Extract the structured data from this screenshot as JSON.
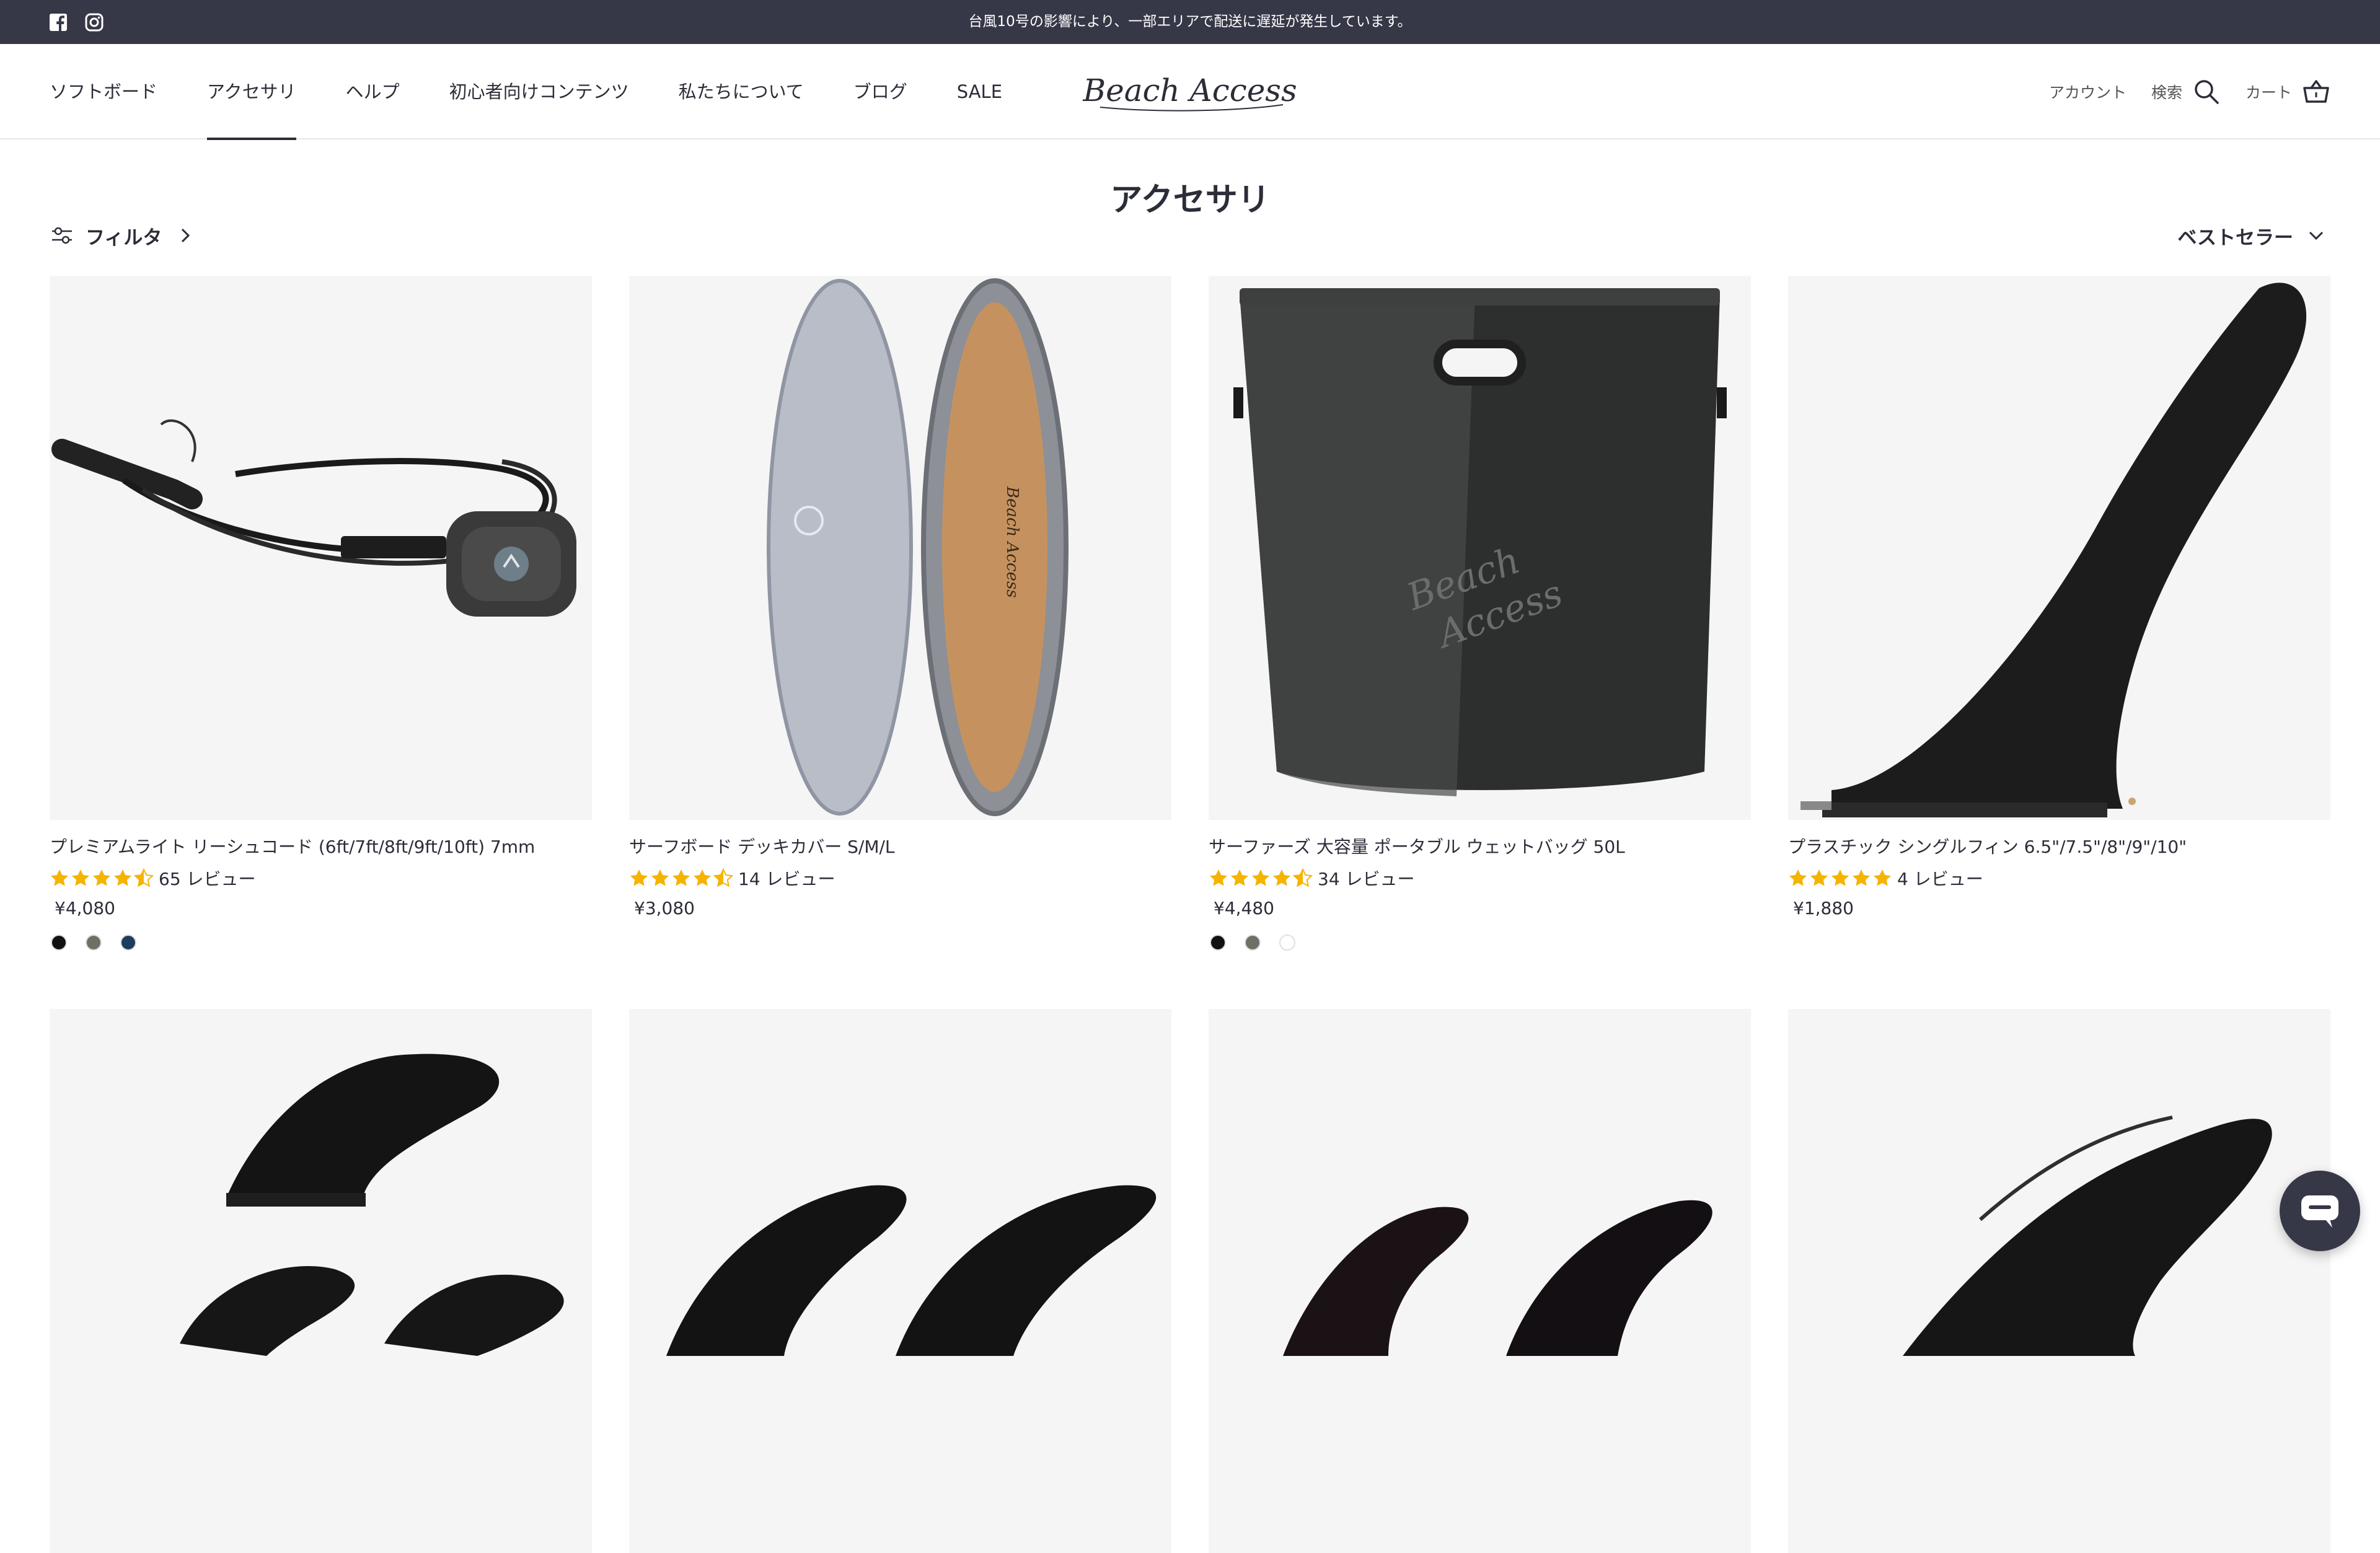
{
  "announcement": {
    "text": "台風10号の影響により、一部エリアで配送に遅延が発生しています。",
    "social_icons": [
      "facebook-icon",
      "instagram-icon"
    ]
  },
  "header": {
    "nav": [
      {
        "label": "ソフトボード",
        "active": false
      },
      {
        "label": "アクセサリ",
        "active": true
      },
      {
        "label": "ヘルプ",
        "active": false
      },
      {
        "label": "初心者向けコンテンツ",
        "active": false
      },
      {
        "label": "私たちについて",
        "active": false
      },
      {
        "label": "ブログ",
        "active": false
      },
      {
        "label": "SALE",
        "active": false
      }
    ],
    "logo_text": "Beach Access",
    "account_label": "アカウント",
    "search_label": "検索",
    "cart_label": "カート"
  },
  "page": {
    "title": "アクセサリ",
    "filter_label": "フィルタ",
    "sort_label": "ベストセラー"
  },
  "products": [
    {
      "name": "プレミアムライト リーシュコード (6ft/7ft/8ft/9ft/10ft) 7mm",
      "rating": 4.5,
      "reviews": "65 レビュー",
      "price": "¥4,080",
      "swatches": [
        "#111111",
        "#6f6f66",
        "#1d3d5c"
      ]
    },
    {
      "name": "サーフボード デッキカバー S/M/L",
      "rating": 4.5,
      "reviews": "14 レビュー",
      "price": "¥3,080",
      "swatches": []
    },
    {
      "name": "サーファーズ 大容量 ポータブル ウェットバッグ 50L",
      "rating": 4.5,
      "reviews": "34 レビュー",
      "price": "¥4,480",
      "swatches": [
        "#111111",
        "#6f6f66",
        "#ffffff"
      ]
    },
    {
      "name": "プラスチック シングルフィン 6.5\"/7.5\"/8\"/9\"/10\"",
      "rating": 5,
      "reviews": "4 レビュー",
      "price": "¥1,880",
      "swatches": []
    }
  ],
  "colors": {
    "announcement_bg": "#363848",
    "star": "#f5b400",
    "text": "#2b2d38"
  }
}
